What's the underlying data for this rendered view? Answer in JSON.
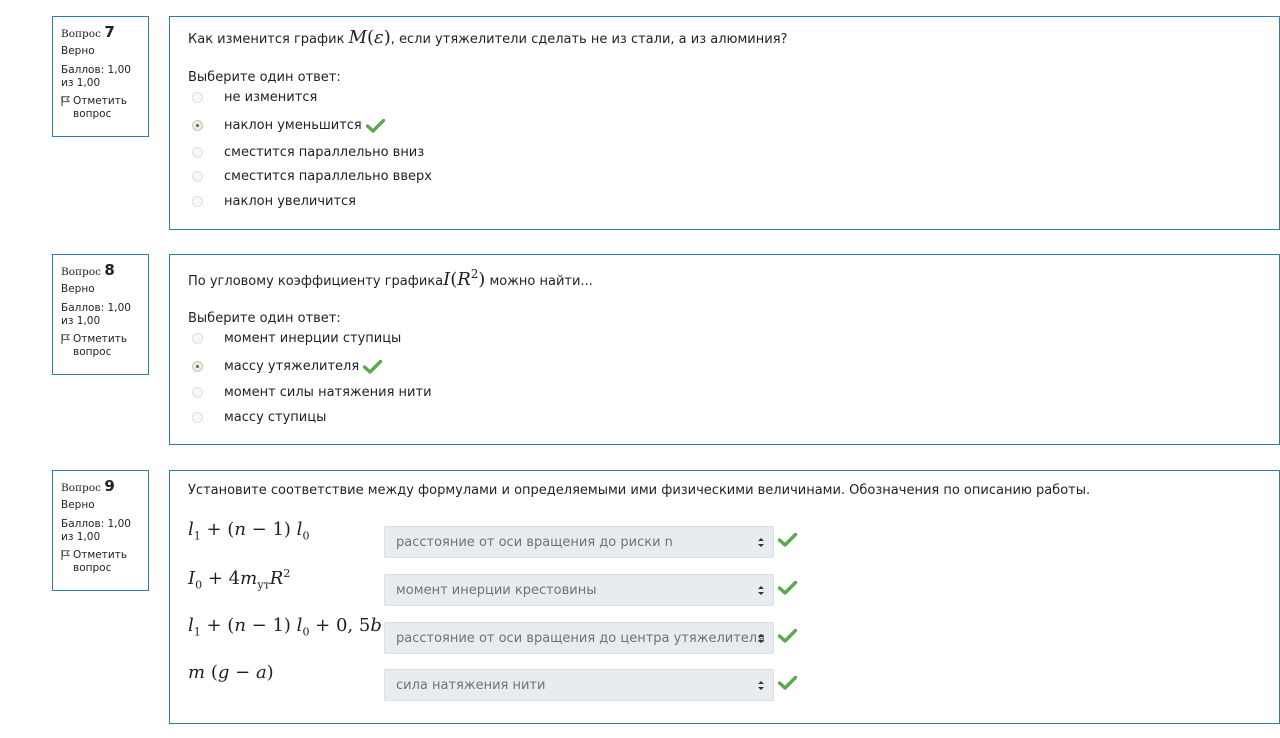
{
  "colors": {
    "border": "#2f7fa6",
    "correct": "#5ca84f",
    "select_bg": "#e9ecef"
  },
  "questions": [
    {
      "label": "Вопрос",
      "number": "7",
      "state": "Верно",
      "grade": "Баллов: 1,00 из 1,00",
      "flag": "Отметить вопрос",
      "text_before": "Как изменится график ",
      "math": "M(ε)",
      "text_after": ", если утяжелители сделать не из стали, а из алюминия?",
      "prompt": "Выберите один ответ:",
      "options": [
        "не изменится",
        "наклон уменьшится",
        "сместится параллельно вниз",
        "сместится параллельно вверх",
        "наклон увеличится"
      ],
      "selected_index": 1
    },
    {
      "label": "Вопрос",
      "number": "8",
      "state": "Верно",
      "grade": "Баллов: 1,00 из 1,00",
      "flag": "Отметить вопрос",
      "text_before": "По угловому коэффициенту графика",
      "math": "I(R²)",
      "text_after": " можно найти...",
      "prompt": "Выберите один ответ:",
      "options": [
        "момент инерции ступицы",
        "массу утяжелителя",
        "момент силы натяжения нити",
        "массу ступицы"
      ],
      "selected_index": 1
    },
    {
      "label": "Вопрос",
      "number": "9",
      "state": "Верно",
      "grade": "Баллов: 1,00 из 1,00",
      "flag": "Отметить вопрос",
      "text": "Установите соответствие между формулами и определяемыми ими физическими величинами. Обозначения по описанию работы.",
      "matches": [
        {
          "formula": "l₁ + (n − 1) l₀",
          "answer": "расстояние от оси вращения до риски n"
        },
        {
          "formula": "I₀ + 4m_ут R²",
          "answer": "момент инерции крестовины"
        },
        {
          "formula": "l₁ + (n − 1) l₀ + 0,5b",
          "answer": "расстояние от оси вращения до центра утяжелителя"
        },
        {
          "formula": "m (g − a)",
          "answer": "сила натяжения нити"
        }
      ]
    }
  ]
}
